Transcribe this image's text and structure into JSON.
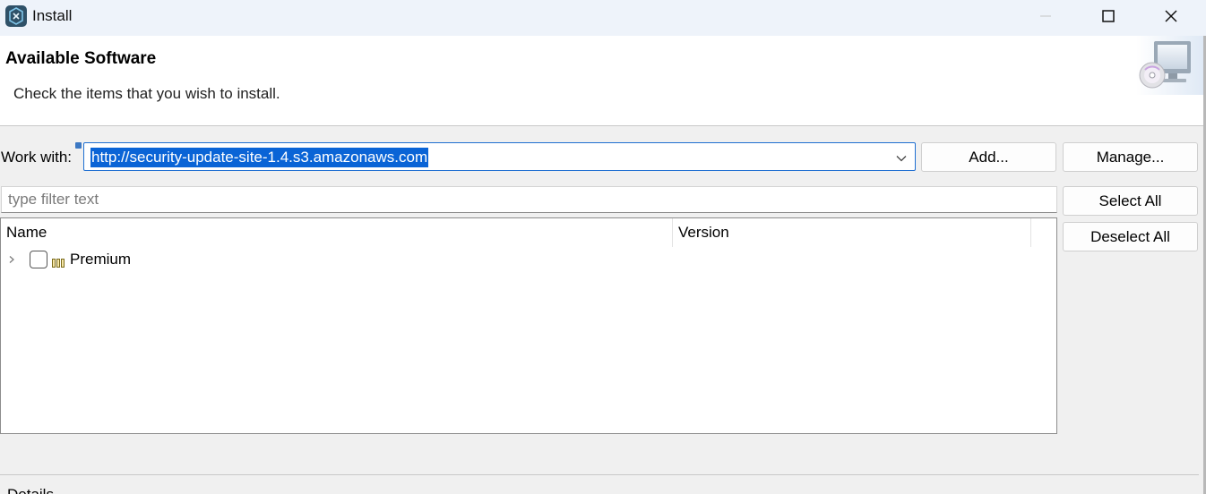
{
  "window": {
    "title": "Install",
    "icon": "eclipse-installer-icon",
    "controls": [
      "minimize-icon",
      "maximize-icon",
      "close-icon"
    ]
  },
  "header": {
    "title": "Available Software",
    "description": "Check the items that you wish to install.",
    "banner_icon": "computer-cd-install-icon"
  },
  "work_with": {
    "label": "Work with:",
    "value": "http://security-update-site-1.4.s3.amazonaws.com",
    "add_label": "Add...",
    "manage_label": "Manage..."
  },
  "filter": {
    "placeholder": "type filter text"
  },
  "table": {
    "columns": [
      "Name",
      "Version"
    ],
    "rows": [
      {
        "label": "Premium",
        "version": "",
        "checked": false,
        "expanded": false,
        "icon": "category-icon"
      }
    ]
  },
  "actions": {
    "select_all_label": "Select All",
    "deselect_all_label": "Deselect All"
  },
  "details": {
    "label": "Details"
  },
  "colors": {
    "selection": "#0a64d6",
    "focus_border": "#1f6fd1",
    "titlebar": "#eef3fa",
    "background": "#f0f0f0"
  }
}
